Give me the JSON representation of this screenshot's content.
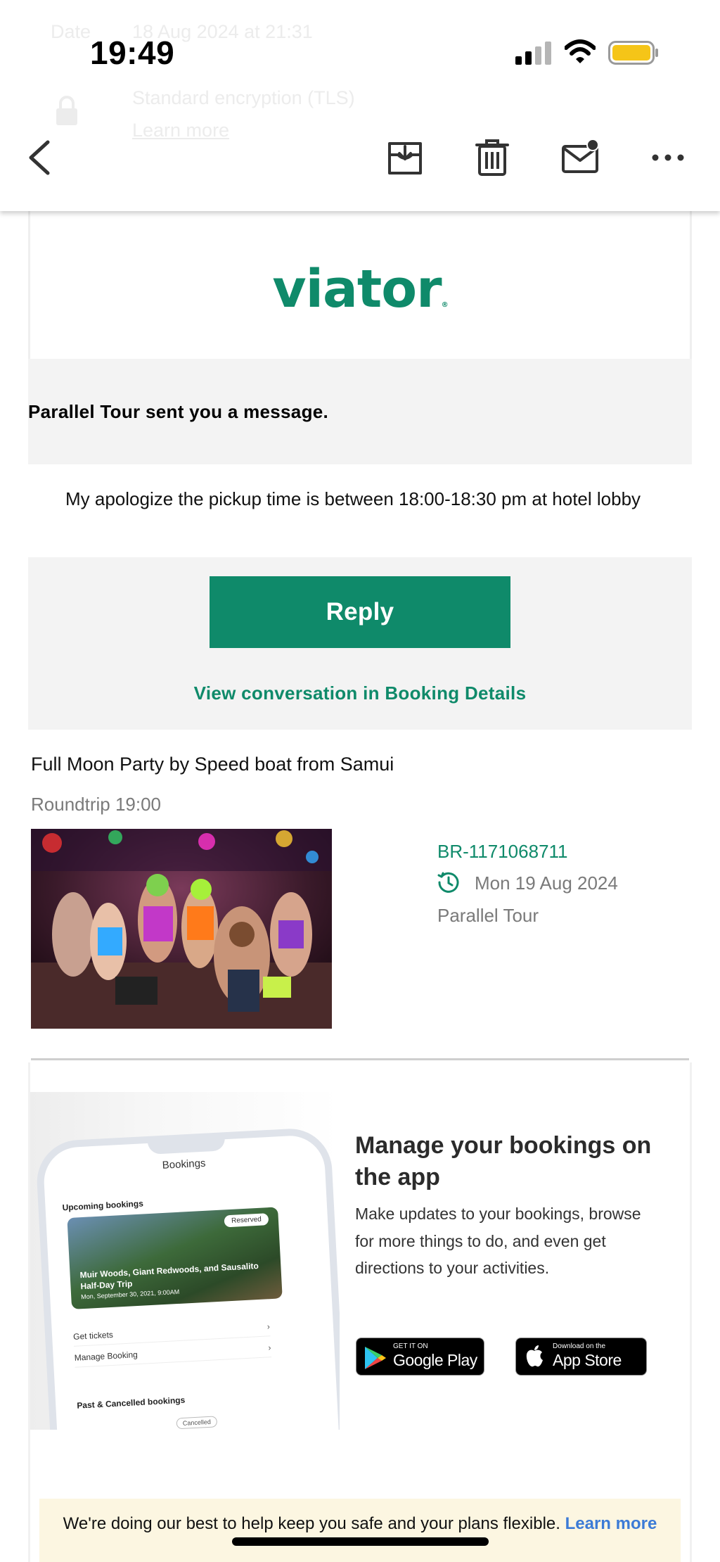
{
  "status_bar": {
    "time": "19:49"
  },
  "background_header": {
    "date_label": "Date",
    "date_value": "18 Aug 2024 at 21:31",
    "encryption": "Standard encryption (TLS)",
    "learn_more": "Learn more"
  },
  "toolbar": {
    "back": "back-icon",
    "archive": "archive-icon",
    "delete": "trash-icon",
    "mark_unread": "mail-unread-icon",
    "more": "more-icon"
  },
  "email": {
    "logo": "viator",
    "sent_message": "Parallel Tour sent you a message.",
    "message": "My apologize the pickup time is between 18:00-18:30 pm at hotel lobby",
    "reply_button": "Reply",
    "view_conversation": "View conversation in Booking Details",
    "tour": {
      "title": "Full Moon Party by Speed boat from Samui",
      "subtitle": "Roundtrip 19:00",
      "booking_ref": "BR-1171068711",
      "date": "Mon 19 Aug 2024",
      "operator": "Parallel Tour"
    },
    "promo": {
      "title": "Manage your bookings on the app",
      "body": "Make updates to your bookings, browse for more things to do, and even get directions to your activities.",
      "google_small": "GET IT ON",
      "google_big": "Google Play",
      "apple_small": "Download on the",
      "apple_big": "App Store",
      "phone_mock": {
        "header": "Bookings",
        "upcoming": "Upcoming bookings",
        "badge": "Reserved",
        "card_title": "Muir Woods, Giant Redwoods, and Sausalito Half-Day Trip",
        "card_date": "Mon, September 30, 2021, 9:00AM",
        "get_tickets": "Get tickets",
        "manage": "Manage Booking",
        "past": "Past & Cancelled bookings",
        "cancelled": "Cancelled"
      }
    },
    "banner": {
      "text": "We're doing our best to help keep you safe and your plans flexible.",
      "link": "Learn more"
    }
  },
  "colors": {
    "brand_green": "#0f8a6a",
    "link_blue": "#3c7bd6",
    "battery": "#f5c518"
  }
}
